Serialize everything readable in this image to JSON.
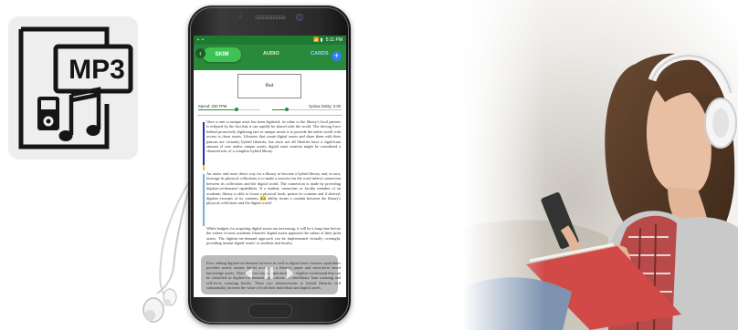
{
  "mp3_tile": {
    "badge_text": "MP3",
    "icon": "mp3-file-icon",
    "colors": {
      "tile_bg": "#eeeeee",
      "glyph": "#151515"
    }
  },
  "phone": {
    "status_bar": {
      "left_icons": "▪ ▪",
      "right_icons": "📶 ▮",
      "clock": "5:11 PM"
    },
    "app_bar": {
      "back_icon": "‹",
      "tabs": [
        {
          "label": "SKIM",
          "active": true
        },
        {
          "label": "AUDIO",
          "active": false
        },
        {
          "label": "CARDS",
          "active": false
        }
      ],
      "add_icon": "+"
    },
    "word_display": "that",
    "controls": {
      "speed_label": "Speed: 250 FPM",
      "syntax_label": "Syntax Delay: 0.00"
    },
    "paragraphs": [
      "Once a rare or unique asset has been digitized, its value to the library's local patrons is eclipsed by the fact that it can rapidly be shared with the world. The driving force behind proactively digitizing rare or unique assets is to provide the entire world with access to those assets. Libraries that create digital assets and share them with their patrons are certainly hybrid libraries, but since not all libraries have a significant amount of rare and/or unique assets, digital asset creation might be considered a characteristic of a complete hybrid library.",
      "An easier and more direct way for a library to become a hybrid library and, in turn, leverage its physical collections is to make a reactive (as the word infers) connection between its collections and the digital world. The connection is made by providing digitize-on-demand capabilities. If a student, researcher or faculty member of an academic library is able to locate a physical book, peruse its contents and if desired, digitize excerpts of its contents, this ability forms a conduit between the library's physical collections and the digital world.",
      "While budgets for acquiring digital assets are increasing, it will be a long time before the values of most academic libraries' digital assets approach the values of their print assets. The digitize-on-demand approach can be implemented virtually overnight, providing instant digital 'assets' to students and faculty.",
      "First, adding digitize-on-demand services as well as digital asset creation capabilities provides nearly instant digital access to a library's paper and microform based knowledge assets. There are two major applications for digitize-on-demand that can be classified as digitize-on-demand applications: 1) interlibrary loan scanning and self-serve scanning kiosks. These two enhancements to hybrid libraries will substantially increase the value of both their individual and digital assets."
    ],
    "highlight_word": "this",
    "nav_icons": [
      "previous-icon",
      "pause-icon",
      "next-icon"
    ],
    "colors": {
      "app_bar": "#2a8a3b",
      "active_tab": "#3ec253",
      "add_button": "#2f7ef0",
      "highlight": "#f2e15a"
    }
  },
  "photo": {
    "description_icon": "woman-with-headphones-photo"
  }
}
